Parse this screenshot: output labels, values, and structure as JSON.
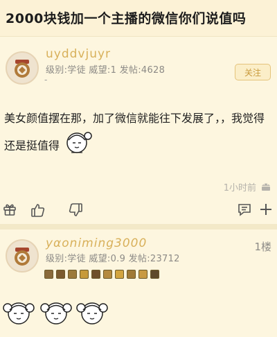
{
  "thread": {
    "title": "2000块钱加一个主播的微信你们说值吗"
  },
  "post1": {
    "username": "uyddvjuyr",
    "meta": "级别:学徒 威望:1 发帖:4628",
    "dash": "-",
    "follow_label": "关注",
    "content": "美女颜值摆在那，加了微信就能往下发展了，，我觉得还是挺值得",
    "time": "1小时前"
  },
  "post2": {
    "username": "yαoniming3000",
    "meta": "级别:学徒 威望:0.9 发帖:23712",
    "floor": "1楼",
    "badge_count": 10
  },
  "colors": {
    "username": "#d8b05a",
    "background": "#fdf6df",
    "follow_border": "#e4c37a"
  },
  "icons": [
    "gift-icon",
    "thumbs-up-icon",
    "thumbs-down-icon",
    "comment-icon",
    "plus-icon",
    "android-icon",
    "sticker-icon"
  ]
}
